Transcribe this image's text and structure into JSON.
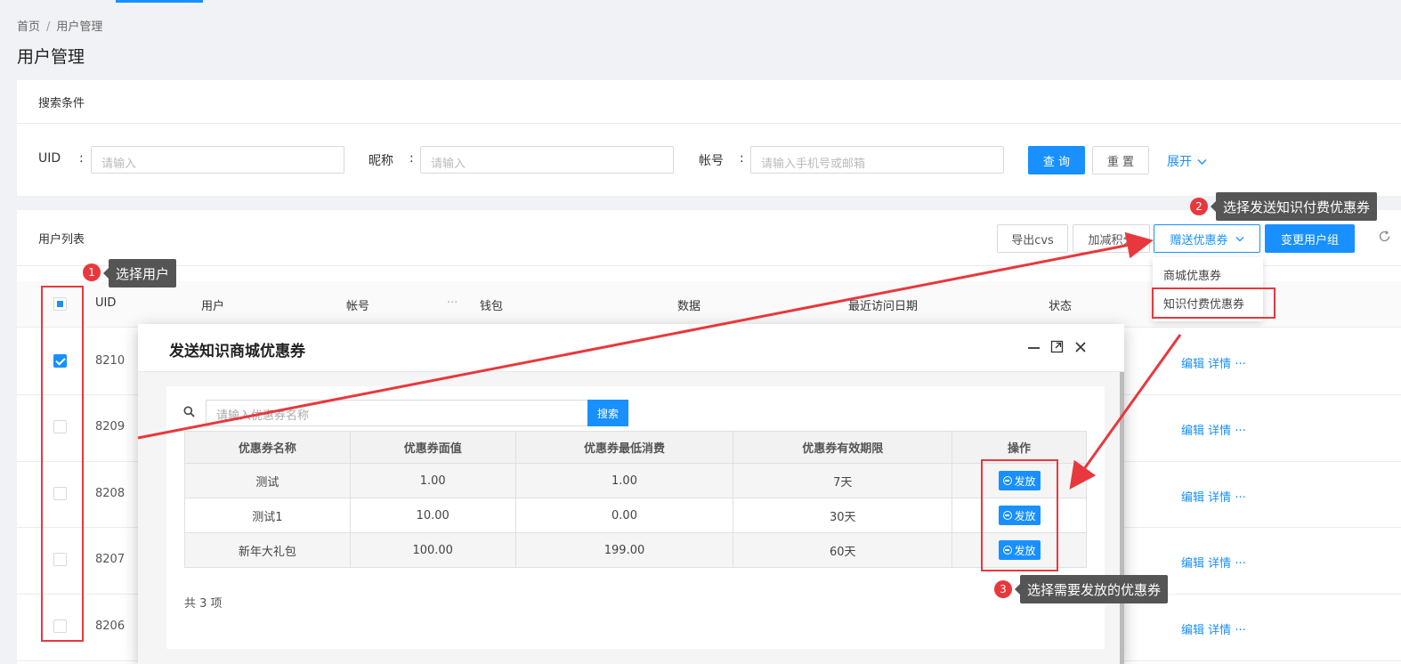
{
  "breadcrumb": {
    "home": "首页",
    "separator": "/",
    "current": "用户管理"
  },
  "page_title": "用户管理",
  "search": {
    "title": "搜索条件",
    "uid_label": "UID",
    "nickname_label": "昵称",
    "account_label": "帐号",
    "colon": ":",
    "uid_placeholder": "请输入",
    "nickname_placeholder": "请输入",
    "account_placeholder": "请输入手机号或邮箱",
    "query_button": "查 询",
    "reset_button": "重 置",
    "expand_link": "展开"
  },
  "user_list": {
    "title": "用户列表",
    "export_button": "导出cvs",
    "points_button": "加减积分",
    "coupon_button": "赠送优惠券",
    "group_button": "变更用户组",
    "columns": [
      "UID",
      "用户",
      "帐号",
      "钱包",
      "数据",
      "最近访问日期",
      "状态"
    ],
    "column_more": "···",
    "rows": [
      {
        "uid": "8210",
        "checked": true
      },
      {
        "uid": "8209",
        "checked": false
      },
      {
        "uid": "8208",
        "checked": false
      },
      {
        "uid": "8207",
        "checked": false
      },
      {
        "uid": "8206",
        "checked": false
      }
    ],
    "op_edit": "编辑",
    "op_detail": "详情",
    "op_more": "···"
  },
  "dropdown": {
    "items": [
      "商城优惠券",
      "知识付费优惠券"
    ]
  },
  "annotations": [
    {
      "num": "1",
      "text": "选择用户"
    },
    {
      "num": "2",
      "text": "选择发送知识付费优惠券"
    },
    {
      "num": "3",
      "text": "选择需要发放的优惠券"
    }
  ],
  "modal": {
    "title": "发送知识商城优惠券",
    "search_placeholder": "请输入优惠券名称",
    "search_button": "搜索",
    "headers": [
      "优惠券名称",
      "优惠券面值",
      "优惠券最低消费",
      "优惠券有效期限",
      "操作"
    ],
    "rows": [
      {
        "name": "测试",
        "value": "1.00",
        "min": "1.00",
        "period": "7天"
      },
      {
        "name": "测试1",
        "value": "10.00",
        "min": "0.00",
        "period": "30天"
      },
      {
        "name": "新年大礼包",
        "value": "100.00",
        "min": "199.00",
        "period": "60天"
      }
    ],
    "issue_label": "发放",
    "total": "共 3 项"
  },
  "colors": {
    "primary": "#1890ff",
    "annotation_red": "#e8383d",
    "tooltip_bg": "#555555"
  }
}
